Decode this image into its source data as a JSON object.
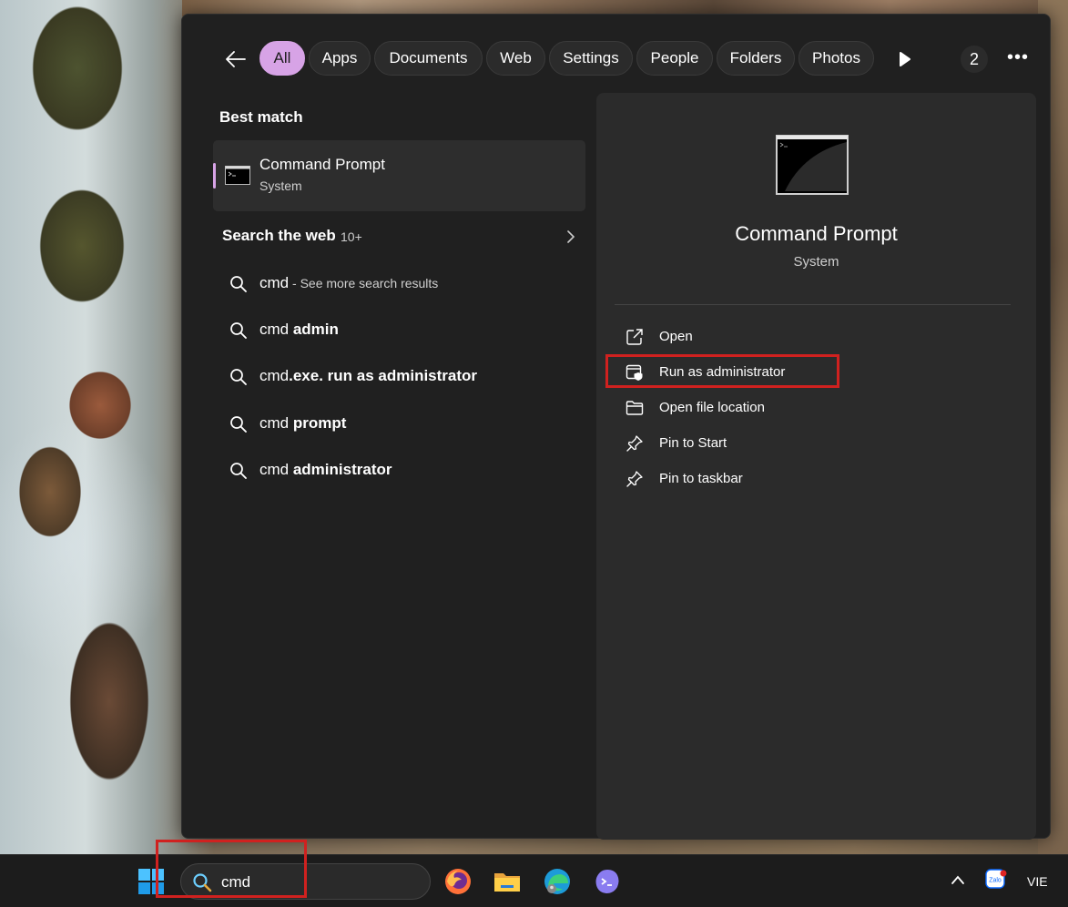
{
  "colors": {
    "accent": "#d7a3e6",
    "panel_bg": "#202020",
    "preview_bg": "#2b2b2b",
    "highlight": "#d0211f"
  },
  "filters": {
    "tabs": [
      {
        "label": "All",
        "active": true
      },
      {
        "label": "Apps"
      },
      {
        "label": "Documents"
      },
      {
        "label": "Web"
      },
      {
        "label": "Settings"
      },
      {
        "label": "People"
      },
      {
        "label": "Folders"
      },
      {
        "label": "Photos"
      }
    ],
    "count": "2",
    "more": "•••"
  },
  "best_match": {
    "title": "Best match",
    "name": "Command Prompt",
    "type": "System",
    "icon": "command-prompt-icon"
  },
  "web": {
    "title": "Search the web",
    "count": "10+",
    "items": [
      {
        "prefix": "cmd",
        "bold": "",
        "suffix": " - See more search results"
      },
      {
        "prefix": "cmd ",
        "bold": "admin",
        "suffix": ""
      },
      {
        "prefix": "cmd",
        "bold": ".exe. run as administrator",
        "suffix": ""
      },
      {
        "prefix": "cmd ",
        "bold": "prompt",
        "suffix": ""
      },
      {
        "prefix": "cmd ",
        "bold": "administrator",
        "suffix": ""
      }
    ]
  },
  "preview": {
    "name": "Command Prompt",
    "type": "System",
    "actions": [
      {
        "label": "Open",
        "icon": "open-external-icon"
      },
      {
        "label": "Run as administrator",
        "icon": "shield-window-icon"
      },
      {
        "label": "Open file location",
        "icon": "folder-icon"
      },
      {
        "label": "Pin to Start",
        "icon": "pin-icon"
      },
      {
        "label": "Pin to taskbar",
        "icon": "pin-icon"
      }
    ]
  },
  "taskbar": {
    "search_value": "cmd",
    "apps": [
      "firefox-icon",
      "file-explorer-icon",
      "edge-icon",
      "terminal-app-icon"
    ],
    "tray_app": "Zalo",
    "language": "VIE"
  }
}
